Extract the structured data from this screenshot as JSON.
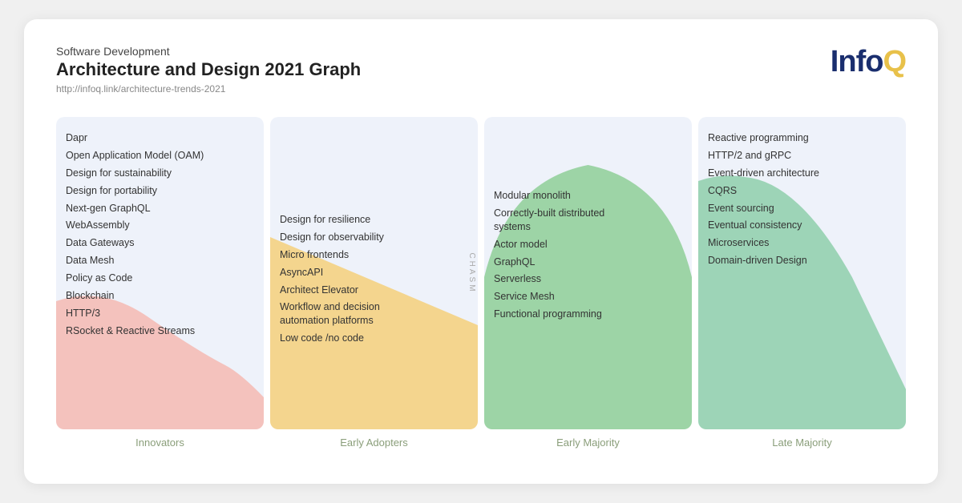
{
  "header": {
    "subtitle": "Software Development",
    "title": "Architecture and Design 2021 Graph",
    "url": "http://infoq.link/architecture-trends-2021",
    "logo": "InfoQ"
  },
  "columns": [
    {
      "id": "innovators",
      "label": "Innovators",
      "color": "#f5c6c0",
      "items": [
        "Dapr",
        "Open Application Model (OAM)",
        "Design for sustainability",
        "Design for portability",
        "Next-gen GraphQL",
        "WebAssembly",
        "Data Gateways",
        "Data Mesh",
        "Policy as Code",
        "Blockchain",
        "HTTP/3",
        "RSocket & Reactive Streams"
      ]
    },
    {
      "id": "early-adopters",
      "label": "Early Adopters",
      "color": "#f5d78e",
      "items": [
        "Design for resilience",
        "Design for observability",
        "Micro frontends",
        "AsyncAPI",
        "Architect Elevator",
        "Workflow and decision automation platforms",
        "Low code /no code"
      ]
    },
    {
      "id": "early-majority",
      "label": "Early Majority",
      "color": "#a8d5a2",
      "items": [
        "Modular monolith",
        "Correctly-built distributed systems",
        "Actor model",
        "GraphQL",
        "Serverless",
        "Service Mesh",
        "Functional programming"
      ]
    },
    {
      "id": "late-majority",
      "label": "Late Majority",
      "color": "#a8d5b8",
      "items": [
        "Reactive programming",
        "HTTP/2 and gRPC",
        "Event-driven architecture",
        "CQRS",
        "Event sourcing",
        "Eventual consistency",
        "Microservices",
        "Domain-driven Design"
      ]
    }
  ],
  "chasm": "CHASM"
}
